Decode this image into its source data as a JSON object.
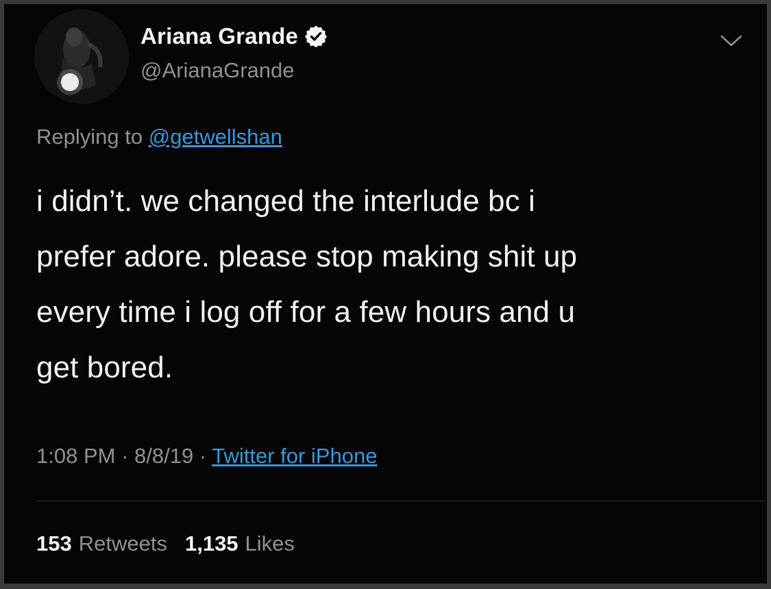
{
  "author": {
    "display_name": "Ariana Grande",
    "handle": "@ArianaGrande",
    "verified": true,
    "avatar": "profile-photo"
  },
  "reply": {
    "prefix": "Replying to",
    "mention": "@getwellshan"
  },
  "tweet": {
    "lines": [
      "i didn’t. we changed the interlude bc i",
      "prefer adore. please stop making shit up",
      "every time i log off for a few hours and u",
      "get bored."
    ]
  },
  "meta": {
    "time": "1:08 PM",
    "separator": " · ",
    "date": "8/8/19",
    "source": "Twitter for iPhone"
  },
  "stats": {
    "retweets_count": "153",
    "retweets_label": "Retweets",
    "likes_count": "1,135",
    "likes_label": "Likes"
  },
  "colors": {
    "background": "#050505",
    "frame": "#3a3a3a",
    "text": "#f2f2f2",
    "muted": "#8e9296",
    "link": "#3a97d9"
  },
  "icons": [
    "verified-badge-icon",
    "chevron-down-icon"
  ]
}
